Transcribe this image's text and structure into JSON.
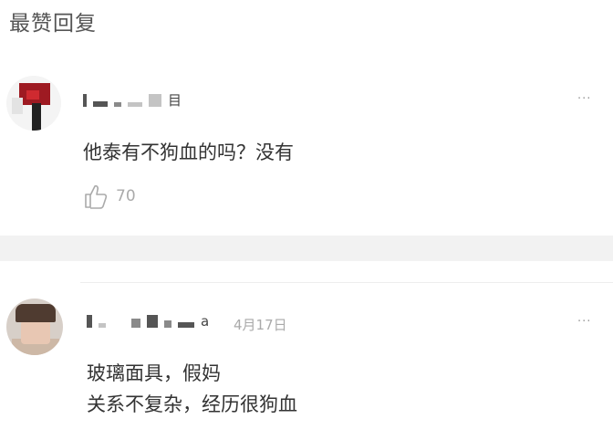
{
  "section": {
    "title": "最赞回复"
  },
  "comments": [
    {
      "username_tail": "目",
      "date": "",
      "more": "···",
      "content": "他泰有不狗血的吗？没有",
      "like_count": "70"
    },
    {
      "username_tail": "a",
      "date": "4月17日",
      "more": "···",
      "content": "玻璃面具，假妈\n关系不复杂，经历很狗血",
      "like_count": ""
    }
  ]
}
